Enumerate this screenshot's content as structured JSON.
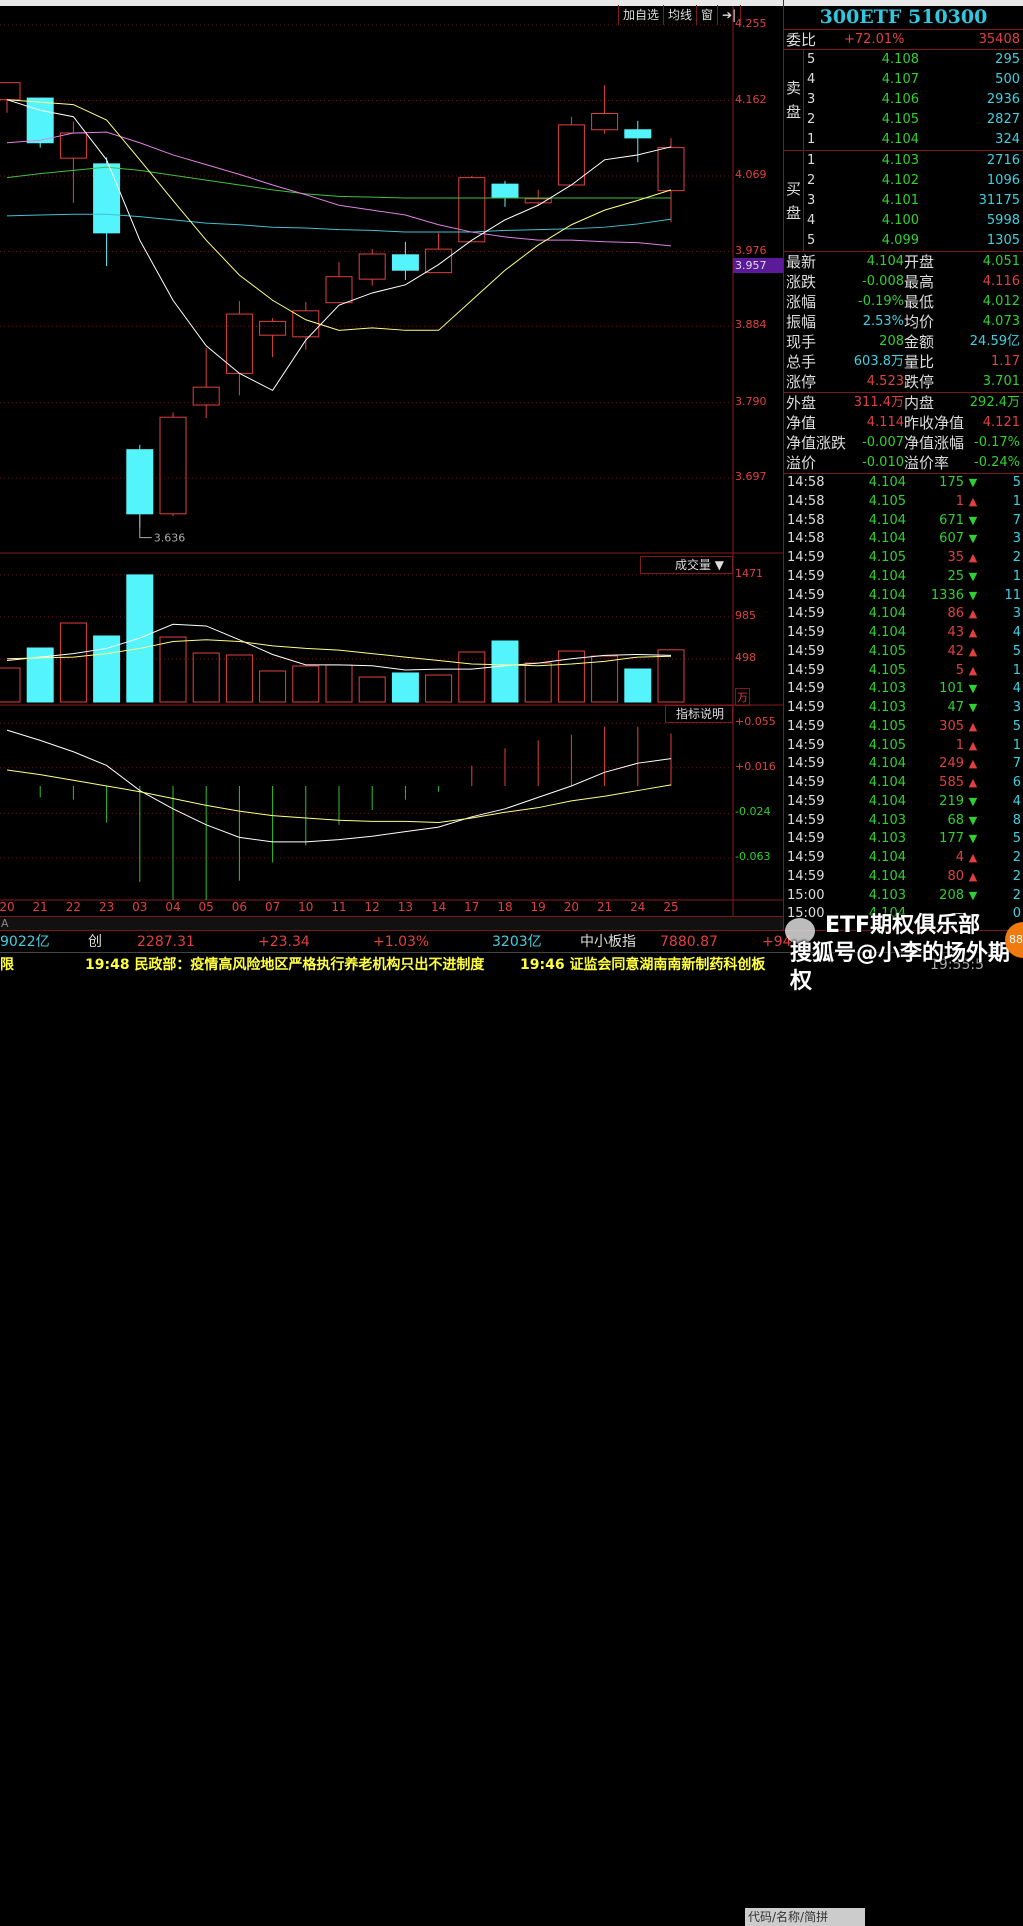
{
  "toolbar": {
    "add_watch": "加自选",
    "ma": "均线",
    "window": "窗",
    "arrow": "➔|"
  },
  "price_axis": [
    "4.255",
    "4.162",
    "4.069",
    "3.976",
    "3.884",
    "3.790",
    "3.697"
  ],
  "current_price_tag": "3.957",
  "low_marker": "3.636",
  "volume_panel": {
    "label": "成交量 ▼",
    "axis": [
      "1471",
      "985",
      "498"
    ],
    "unit": "万"
  },
  "macd_panel": {
    "label": "指标说明",
    "axis": [
      "+0.055",
      "+0.016",
      "-0.024",
      "-0.063"
    ]
  },
  "colors": {
    "up": "#e04040",
    "down": "#54f4fc",
    "ma5": "#ffffff",
    "ma10": "#ffff80",
    "ma20": "#e080e0",
    "ma30": "#40c040",
    "ma60": "#40c0d0",
    "grid": "#6a1010"
  },
  "chart_data": {
    "type": "candlestick",
    "dates": [
      "20",
      "21",
      "22",
      "23",
      "03",
      "04",
      "05",
      "06",
      "07",
      "10",
      "11",
      "12",
      "13",
      "14",
      "17",
      "18",
      "19",
      "20",
      "21",
      "24",
      "25"
    ],
    "ohlc": [
      [
        4.163,
        4.184,
        4.184,
        4.147
      ],
      [
        4.165,
        4.11,
        4.165,
        4.104
      ],
      [
        4.091,
        4.122,
        4.136,
        4.036
      ],
      [
        4.084,
        3.999,
        4.092,
        3.958
      ],
      [
        3.732,
        3.653,
        3.738,
        3.636
      ],
      [
        3.653,
        3.772,
        3.778,
        3.65
      ],
      [
        3.787,
        3.809,
        3.857,
        3.771
      ],
      [
        3.826,
        3.899,
        3.915,
        3.799
      ],
      [
        3.873,
        3.89,
        3.894,
        3.846
      ],
      [
        3.871,
        3.903,
        3.914,
        3.855
      ],
      [
        3.913,
        3.945,
        3.963,
        3.913
      ],
      [
        3.942,
        3.973,
        3.979,
        3.934
      ],
      [
        3.972,
        3.953,
        3.988,
        3.941
      ],
      [
        3.95,
        3.979,
        3.999,
        3.95
      ],
      [
        3.988,
        4.067,
        4.069,
        3.988
      ],
      [
        4.059,
        4.043,
        4.063,
        4.031
      ],
      [
        4.036,
        4.041,
        4.052,
        4.032
      ],
      [
        4.058,
        4.132,
        4.142,
        4.058
      ],
      [
        4.126,
        4.146,
        4.181,
        4.121
      ],
      [
        4.126,
        4.116,
        4.137,
        4.086
      ],
      [
        4.051,
        4.104,
        4.116,
        4.012
      ]
    ],
    "ma": {
      "ma5": [
        4.163,
        4.15,
        4.142,
        4.089,
        3.99,
        3.916,
        3.86,
        3.826,
        3.805,
        3.867,
        3.91,
        3.925,
        3.935,
        3.96,
        3.99,
        4.015,
        4.033,
        4.058,
        4.089,
        4.095,
        4.105
      ],
      "ma10": [
        4.163,
        4.16,
        4.157,
        4.138,
        4.089,
        4.039,
        3.99,
        3.947,
        3.916,
        3.892,
        3.879,
        3.882,
        3.879,
        3.879,
        3.916,
        3.953,
        3.984,
        4.009,
        4.027,
        4.039,
        4.052
      ],
      "ma20": [
        4.11,
        4.113,
        4.122,
        4.123,
        4.11,
        4.095,
        4.083,
        4.071,
        4.058,
        4.046,
        4.033,
        4.027,
        4.021,
        4.009,
        4.0,
        3.994,
        3.99,
        3.99,
        3.988,
        3.987,
        3.983
      ],
      "ma30": [
        4.067,
        4.072,
        4.076,
        4.08,
        4.076,
        4.07,
        4.064,
        4.058,
        4.052,
        4.047,
        4.044,
        4.043,
        4.042,
        4.042,
        4.042,
        4.042,
        4.042,
        4.042,
        4.042,
        4.042,
        4.042
      ],
      "ma60": [
        4.02,
        4.021,
        4.022,
        4.022,
        4.019,
        4.015,
        4.011,
        4.009,
        4.006,
        4.005,
        4.003,
        4.002,
        4.0,
        4.0,
        4.0,
        4.002,
        4.003,
        4.004,
        4.006,
        4.01,
        4.016
      ]
    },
    "price_range": [
      3.62,
      4.27
    ],
    "volume": [
      393,
      625,
      914,
      764,
      1471,
      752,
      567,
      544,
      359,
      417,
      428,
      289,
      336,
      312,
      579,
      706,
      451,
      590,
      532,
      382,
      604
    ],
    "volume_ma5": [
      480,
      520,
      560,
      620,
      740,
      900,
      880,
      720,
      550,
      430,
      430,
      420,
      370,
      380,
      380,
      420,
      450,
      500,
      540,
      550,
      540
    ],
    "volume_ma10": [
      500,
      510,
      520,
      560,
      620,
      700,
      720,
      700,
      650,
      620,
      600,
      560,
      520,
      480,
      440,
      430,
      420,
      440,
      470,
      520,
      530
    ],
    "macd_hist": [
      0,
      -0.01,
      -0.012,
      -0.032,
      -0.084,
      -0.1,
      -0.1,
      -0.083,
      -0.067,
      -0.052,
      -0.034,
      -0.021,
      -0.012,
      -0.005,
      0.018,
      0.033,
      0.04,
      0.045,
      0.052,
      0.052,
      0.046
    ],
    "dif": [
      0.049,
      0.04,
      0.03,
      0.018,
      -0.004,
      -0.02,
      -0.034,
      -0.045,
      -0.049,
      -0.049,
      -0.047,
      -0.044,
      -0.04,
      -0.036,
      -0.027,
      -0.02,
      -0.01,
      0.0,
      0.012,
      0.02,
      0.024
    ],
    "dea": [
      0.014,
      0.01,
      0.005,
      0.0,
      -0.005,
      -0.011,
      -0.017,
      -0.022,
      -0.026,
      -0.028,
      -0.03,
      -0.031,
      -0.031,
      -0.032,
      -0.028,
      -0.023,
      -0.019,
      -0.013,
      -0.009,
      -0.004,
      0.001
    ]
  },
  "quote": {
    "title": "300ETF 510300",
    "ratio_label": "委比",
    "ratio": "+72.01%",
    "ratio_diff": "35408",
    "sell_label": [
      "卖",
      "盘"
    ],
    "buy_label": [
      "买",
      "盘"
    ],
    "sell": [
      [
        "5",
        "4.108",
        "295"
      ],
      [
        "4",
        "4.107",
        "500"
      ],
      [
        "3",
        "4.106",
        "2936"
      ],
      [
        "2",
        "4.105",
        "2827"
      ],
      [
        "1",
        "4.104",
        "324"
      ]
    ],
    "buy": [
      [
        "1",
        "4.103",
        "2716"
      ],
      [
        "2",
        "4.102",
        "1096"
      ],
      [
        "3",
        "4.101",
        "31175"
      ],
      [
        "4",
        "4.100",
        "5998"
      ],
      [
        "5",
        "4.099",
        "1305"
      ]
    ],
    "stats": [
      {
        "k": "最新",
        "v": "4.104",
        "c": "grn",
        "k2": "开盘",
        "v2": "4.051",
        "c2": "grn"
      },
      {
        "k": "涨跌",
        "v": "-0.008",
        "c": "grn",
        "k2": "最高",
        "v2": "4.116",
        "c2": "red"
      },
      {
        "k": "涨幅",
        "v": "-0.19%",
        "c": "grn",
        "k2": "最低",
        "v2": "4.012",
        "c2": "grn"
      },
      {
        "k": "振幅",
        "v": "2.53%",
        "c": "cyn",
        "k2": "均价",
        "v2": "4.073",
        "c2": "grn"
      },
      {
        "k": "现手",
        "v": "208",
        "c": "grn",
        "k2": "金额",
        "v2": "24.59亿",
        "c2": "cyn"
      },
      {
        "k": "总手",
        "v": "603.8万",
        "c": "cyn",
        "k2": "量比",
        "v2": "1.17",
        "c2": "red"
      },
      {
        "k": "涨停",
        "v": "4.523",
        "c": "red",
        "k2": "跌停",
        "v2": "3.701",
        "c2": "grn"
      }
    ],
    "stats2": [
      {
        "k": "外盘",
        "v": "311.4万",
        "c": "red",
        "k2": "内盘",
        "v2": "292.4万",
        "c2": "grn"
      },
      {
        "k": "净值",
        "v": "4.114",
        "c": "red",
        "k2": "昨收净值",
        "v2": "4.121",
        "c2": "red"
      },
      {
        "k": "净值涨跌",
        "v": "-0.007",
        "c": "grn",
        "k2": "净值涨幅",
        "v2": "-0.17%",
        "c2": "grn"
      },
      {
        "k": "溢价",
        "v": "-0.010",
        "c": "grn",
        "k2": "溢价率",
        "v2": "-0.24%",
        "c2": "grn"
      }
    ],
    "trades": [
      [
        "14:58",
        "4.104",
        "175",
        "down",
        "5"
      ],
      [
        "14:58",
        "4.105",
        "1",
        "up",
        "1"
      ],
      [
        "14:58",
        "4.104",
        "671",
        "down",
        "7"
      ],
      [
        "14:58",
        "4.104",
        "607",
        "down",
        "3"
      ],
      [
        "14:59",
        "4.105",
        "35",
        "up",
        "2"
      ],
      [
        "14:59",
        "4.104",
        "25",
        "down",
        "1"
      ],
      [
        "14:59",
        "4.104",
        "1336",
        "down",
        "11"
      ],
      [
        "14:59",
        "4.104",
        "86",
        "up",
        "3"
      ],
      [
        "14:59",
        "4.104",
        "43",
        "up",
        "4"
      ],
      [
        "14:59",
        "4.105",
        "42",
        "up",
        "5"
      ],
      [
        "14:59",
        "4.105",
        "5",
        "up",
        "1"
      ],
      [
        "14:59",
        "4.103",
        "101",
        "down",
        "4"
      ],
      [
        "14:59",
        "4.103",
        "47",
        "down",
        "3"
      ],
      [
        "14:59",
        "4.105",
        "305",
        "up",
        "5"
      ],
      [
        "14:59",
        "4.105",
        "1",
        "up",
        "1"
      ],
      [
        "14:59",
        "4.104",
        "249",
        "up",
        "7"
      ],
      [
        "14:59",
        "4.104",
        "585",
        "up",
        "6"
      ],
      [
        "14:59",
        "4.104",
        "219",
        "down",
        "4"
      ],
      [
        "14:59",
        "4.103",
        "68",
        "down",
        "8"
      ],
      [
        "14:59",
        "4.103",
        "177",
        "down",
        "5"
      ],
      [
        "14:59",
        "4.104",
        "4",
        "up",
        "2"
      ],
      [
        "14:59",
        "4.104",
        "80",
        "up",
        "2"
      ],
      [
        "15:00",
        "4.103",
        "208",
        "down",
        "2"
      ],
      [
        "15:00",
        "4.104",
        "—",
        "none",
        "0"
      ]
    ]
  },
  "bottom": {
    "a_label": "A",
    "index": [
      "9022亿",
      "创",
      "2287.31",
      "+23.34",
      "+1.03%",
      "3203亿",
      "中小板指",
      "7880.87",
      "+94"
    ],
    "news": [
      "限",
      "19:48 民政部：疫情高风险地区严格执行养老机构只出不进制度",
      "19:46 证监会同意湖南南新制药科创板"
    ],
    "code_placeholder": "代码/名称/简拼",
    "clock": "19:55:5"
  },
  "watermark": {
    "line1": "ETF期权俱乐部",
    "line2": "搜狐号@小李的场外期权",
    "badge": "88"
  }
}
